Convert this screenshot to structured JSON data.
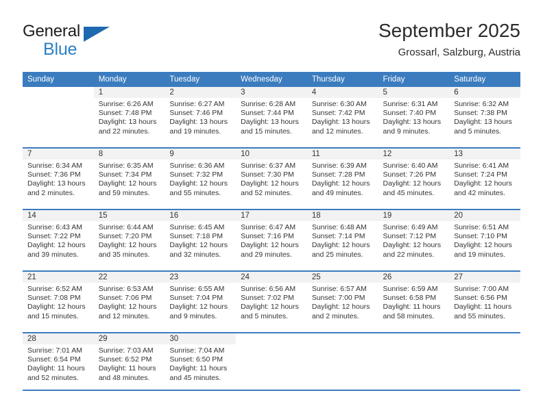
{
  "brand": {
    "name_top": "General",
    "name_bottom": "Blue",
    "triangle_color": "#1f69b0",
    "blue_color": "#2a7fc4"
  },
  "header": {
    "title": "September 2025",
    "subtitle": "Grossarl, Salzburg, Austria"
  },
  "theme": {
    "header_blue": "#3b7cbf",
    "daynum_band": "#f2f2f2",
    "text": "#333333"
  },
  "weekday_headers": [
    "Sunday",
    "Monday",
    "Tuesday",
    "Wednesday",
    "Thursday",
    "Friday",
    "Saturday"
  ],
  "weeks": [
    [
      {
        "day": "",
        "sunrise": "",
        "sunset": "",
        "daylight_line1": "",
        "daylight_line2": "",
        "blank": true
      },
      {
        "day": "1",
        "sunrise": "Sunrise: 6:26 AM",
        "sunset": "Sunset: 7:48 PM",
        "daylight_line1": "Daylight: 13 hours",
        "daylight_line2": "and 22 minutes."
      },
      {
        "day": "2",
        "sunrise": "Sunrise: 6:27 AM",
        "sunset": "Sunset: 7:46 PM",
        "daylight_line1": "Daylight: 13 hours",
        "daylight_line2": "and 19 minutes."
      },
      {
        "day": "3",
        "sunrise": "Sunrise: 6:28 AM",
        "sunset": "Sunset: 7:44 PM",
        "daylight_line1": "Daylight: 13 hours",
        "daylight_line2": "and 15 minutes."
      },
      {
        "day": "4",
        "sunrise": "Sunrise: 6:30 AM",
        "sunset": "Sunset: 7:42 PM",
        "daylight_line1": "Daylight: 13 hours",
        "daylight_line2": "and 12 minutes."
      },
      {
        "day": "5",
        "sunrise": "Sunrise: 6:31 AM",
        "sunset": "Sunset: 7:40 PM",
        "daylight_line1": "Daylight: 13 hours",
        "daylight_line2": "and 9 minutes."
      },
      {
        "day": "6",
        "sunrise": "Sunrise: 6:32 AM",
        "sunset": "Sunset: 7:38 PM",
        "daylight_line1": "Daylight: 13 hours",
        "daylight_line2": "and 5 minutes."
      }
    ],
    [
      {
        "day": "7",
        "sunrise": "Sunrise: 6:34 AM",
        "sunset": "Sunset: 7:36 PM",
        "daylight_line1": "Daylight: 13 hours",
        "daylight_line2": "and 2 minutes."
      },
      {
        "day": "8",
        "sunrise": "Sunrise: 6:35 AM",
        "sunset": "Sunset: 7:34 PM",
        "daylight_line1": "Daylight: 12 hours",
        "daylight_line2": "and 59 minutes."
      },
      {
        "day": "9",
        "sunrise": "Sunrise: 6:36 AM",
        "sunset": "Sunset: 7:32 PM",
        "daylight_line1": "Daylight: 12 hours",
        "daylight_line2": "and 55 minutes."
      },
      {
        "day": "10",
        "sunrise": "Sunrise: 6:37 AM",
        "sunset": "Sunset: 7:30 PM",
        "daylight_line1": "Daylight: 12 hours",
        "daylight_line2": "and 52 minutes."
      },
      {
        "day": "11",
        "sunrise": "Sunrise: 6:39 AM",
        "sunset": "Sunset: 7:28 PM",
        "daylight_line1": "Daylight: 12 hours",
        "daylight_line2": "and 49 minutes."
      },
      {
        "day": "12",
        "sunrise": "Sunrise: 6:40 AM",
        "sunset": "Sunset: 7:26 PM",
        "daylight_line1": "Daylight: 12 hours",
        "daylight_line2": "and 45 minutes."
      },
      {
        "day": "13",
        "sunrise": "Sunrise: 6:41 AM",
        "sunset": "Sunset: 7:24 PM",
        "daylight_line1": "Daylight: 12 hours",
        "daylight_line2": "and 42 minutes."
      }
    ],
    [
      {
        "day": "14",
        "sunrise": "Sunrise: 6:43 AM",
        "sunset": "Sunset: 7:22 PM",
        "daylight_line1": "Daylight: 12 hours",
        "daylight_line2": "and 39 minutes."
      },
      {
        "day": "15",
        "sunrise": "Sunrise: 6:44 AM",
        "sunset": "Sunset: 7:20 PM",
        "daylight_line1": "Daylight: 12 hours",
        "daylight_line2": "and 35 minutes."
      },
      {
        "day": "16",
        "sunrise": "Sunrise: 6:45 AM",
        "sunset": "Sunset: 7:18 PM",
        "daylight_line1": "Daylight: 12 hours",
        "daylight_line2": "and 32 minutes."
      },
      {
        "day": "17",
        "sunrise": "Sunrise: 6:47 AM",
        "sunset": "Sunset: 7:16 PM",
        "daylight_line1": "Daylight: 12 hours",
        "daylight_line2": "and 29 minutes."
      },
      {
        "day": "18",
        "sunrise": "Sunrise: 6:48 AM",
        "sunset": "Sunset: 7:14 PM",
        "daylight_line1": "Daylight: 12 hours",
        "daylight_line2": "and 25 minutes."
      },
      {
        "day": "19",
        "sunrise": "Sunrise: 6:49 AM",
        "sunset": "Sunset: 7:12 PM",
        "daylight_line1": "Daylight: 12 hours",
        "daylight_line2": "and 22 minutes."
      },
      {
        "day": "20",
        "sunrise": "Sunrise: 6:51 AM",
        "sunset": "Sunset: 7:10 PM",
        "daylight_line1": "Daylight: 12 hours",
        "daylight_line2": "and 19 minutes."
      }
    ],
    [
      {
        "day": "21",
        "sunrise": "Sunrise: 6:52 AM",
        "sunset": "Sunset: 7:08 PM",
        "daylight_line1": "Daylight: 12 hours",
        "daylight_line2": "and 15 minutes."
      },
      {
        "day": "22",
        "sunrise": "Sunrise: 6:53 AM",
        "sunset": "Sunset: 7:06 PM",
        "daylight_line1": "Daylight: 12 hours",
        "daylight_line2": "and 12 minutes."
      },
      {
        "day": "23",
        "sunrise": "Sunrise: 6:55 AM",
        "sunset": "Sunset: 7:04 PM",
        "daylight_line1": "Daylight: 12 hours",
        "daylight_line2": "and 9 minutes."
      },
      {
        "day": "24",
        "sunrise": "Sunrise: 6:56 AM",
        "sunset": "Sunset: 7:02 PM",
        "daylight_line1": "Daylight: 12 hours",
        "daylight_line2": "and 5 minutes."
      },
      {
        "day": "25",
        "sunrise": "Sunrise: 6:57 AM",
        "sunset": "Sunset: 7:00 PM",
        "daylight_line1": "Daylight: 12 hours",
        "daylight_line2": "and 2 minutes."
      },
      {
        "day": "26",
        "sunrise": "Sunrise: 6:59 AM",
        "sunset": "Sunset: 6:58 PM",
        "daylight_line1": "Daylight: 11 hours",
        "daylight_line2": "and 58 minutes."
      },
      {
        "day": "27",
        "sunrise": "Sunrise: 7:00 AM",
        "sunset": "Sunset: 6:56 PM",
        "daylight_line1": "Daylight: 11 hours",
        "daylight_line2": "and 55 minutes."
      }
    ],
    [
      {
        "day": "28",
        "sunrise": "Sunrise: 7:01 AM",
        "sunset": "Sunset: 6:54 PM",
        "daylight_line1": "Daylight: 11 hours",
        "daylight_line2": "and 52 minutes."
      },
      {
        "day": "29",
        "sunrise": "Sunrise: 7:03 AM",
        "sunset": "Sunset: 6:52 PM",
        "daylight_line1": "Daylight: 11 hours",
        "daylight_line2": "and 48 minutes."
      },
      {
        "day": "30",
        "sunrise": "Sunrise: 7:04 AM",
        "sunset": "Sunset: 6:50 PM",
        "daylight_line1": "Daylight: 11 hours",
        "daylight_line2": "and 45 minutes."
      },
      {
        "day": "",
        "sunrise": "",
        "sunset": "",
        "daylight_line1": "",
        "daylight_line2": "",
        "blank": true
      },
      {
        "day": "",
        "sunrise": "",
        "sunset": "",
        "daylight_line1": "",
        "daylight_line2": "",
        "blank": true
      },
      {
        "day": "",
        "sunrise": "",
        "sunset": "",
        "daylight_line1": "",
        "daylight_line2": "",
        "blank": true
      },
      {
        "day": "",
        "sunrise": "",
        "sunset": "",
        "daylight_line1": "",
        "daylight_line2": "",
        "blank": true
      }
    ]
  ]
}
